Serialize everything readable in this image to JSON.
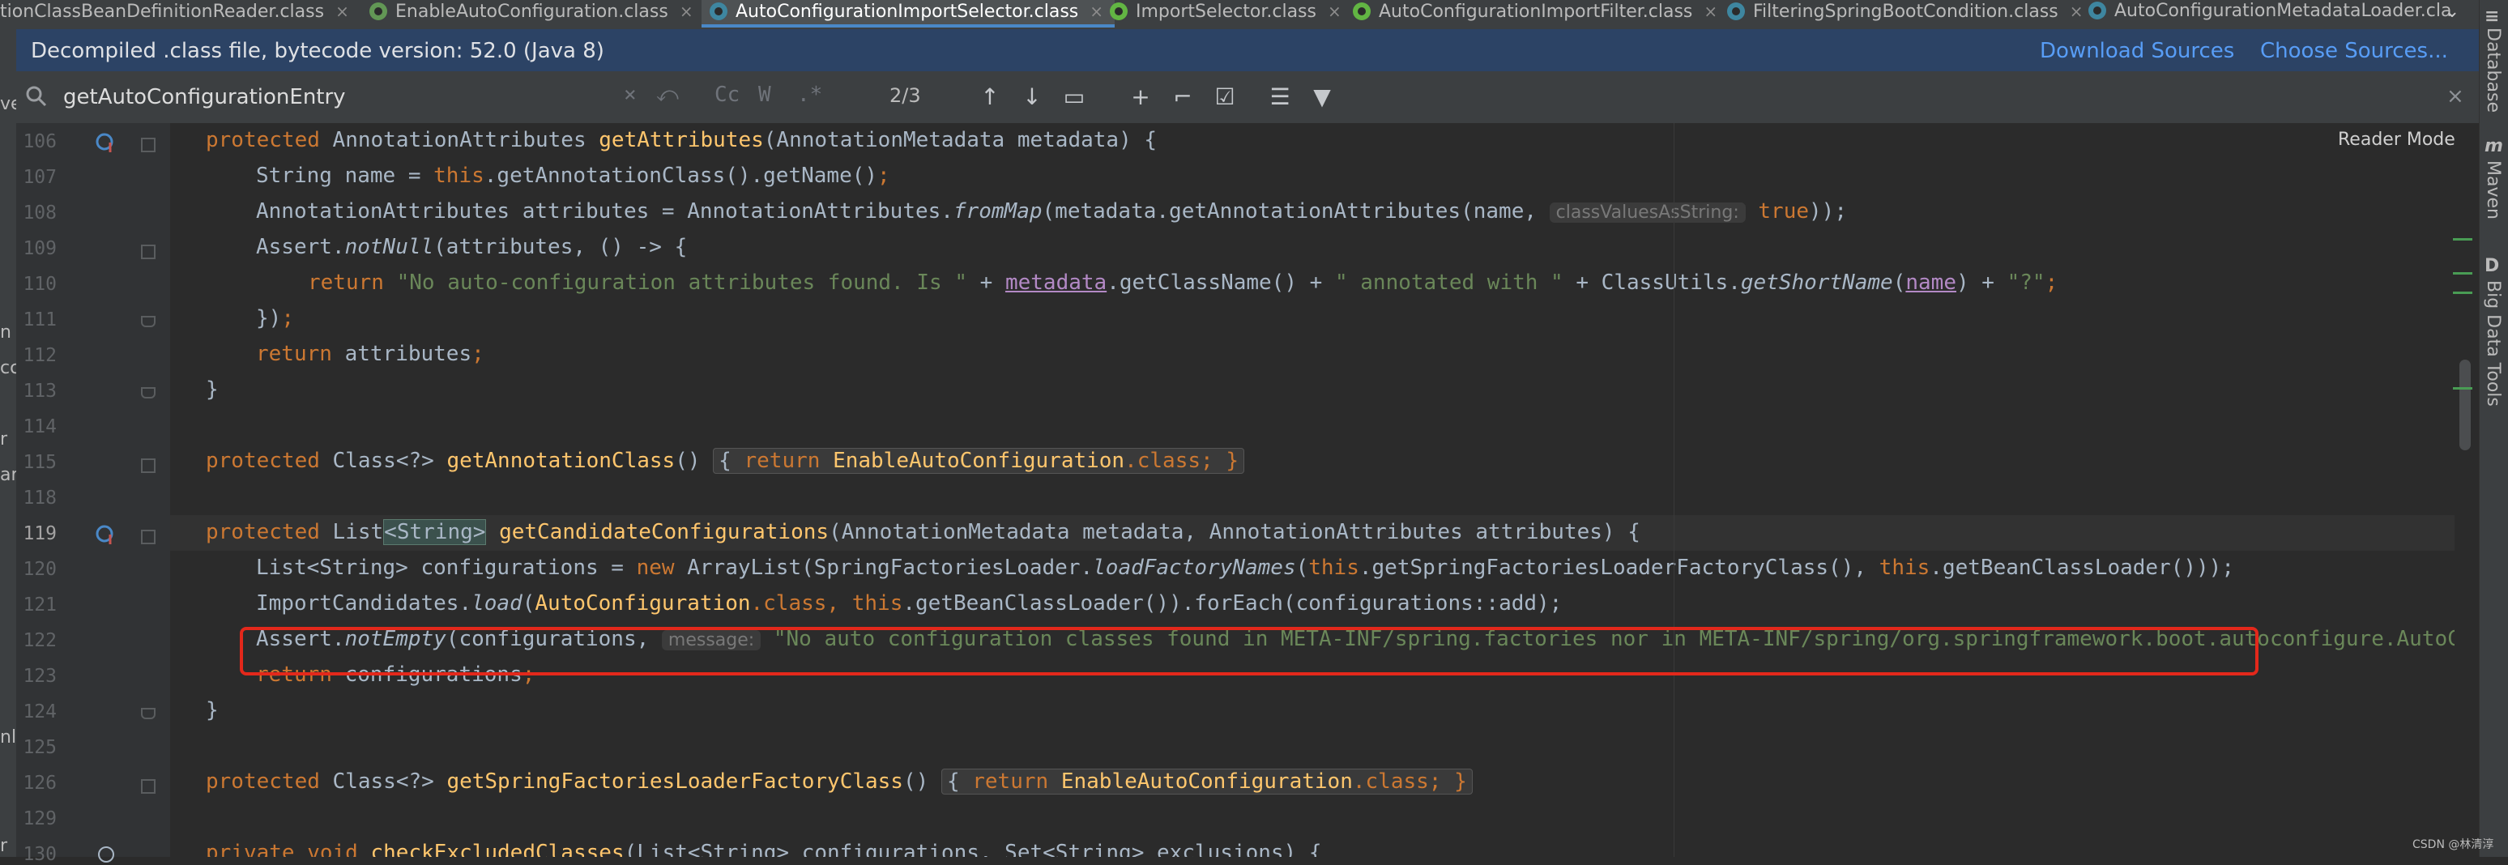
{
  "tabs": [
    {
      "label": "tionClassBeanDefinitionReader.class",
      "icon": "class-icon",
      "active": false
    },
    {
      "label": "EnableAutoConfiguration.class",
      "icon": "annotation-icon",
      "active": false
    },
    {
      "label": "AutoConfigurationImportSelector.class",
      "icon": "class-icon",
      "active": true
    },
    {
      "label": "ImportSelector.class",
      "icon": "interface-icon",
      "active": false
    },
    {
      "label": "AutoConfigurationImportFilter.class",
      "icon": "interface-icon",
      "active": false
    },
    {
      "label": "FilteringSpringBootCondition.class",
      "icon": "class-icon",
      "active": false
    },
    {
      "label": "AutoConfigurationMetadataLoader.cla",
      "icon": "class-icon",
      "active": false
    }
  ],
  "tab_close_glyph": "×",
  "banner": {
    "text": "Decompiled .class file, bytecode version: 52.0 (Java 8)",
    "download_sources": "Download Sources",
    "choose_sources": "Choose Sources..."
  },
  "search": {
    "value": "getAutoConfigurationEntry",
    "match_count": "2/3",
    "case_label": "Cc",
    "word_label": "W",
    "regex_label": ".*"
  },
  "reader_mode": "Reader Mode",
  "right_tools": {
    "database": "Database",
    "maven": "Maven",
    "big_data_tools": "Big Data Tools"
  },
  "left_panel_fragments": [
    "ve",
    "n",
    "cc",
    "r",
    "ar",
    "nl",
    "r"
  ],
  "lines": [
    {
      "n": "106",
      "gutter": "override"
    },
    {
      "n": "107"
    },
    {
      "n": "108"
    },
    {
      "n": "109"
    },
    {
      "n": "110"
    },
    {
      "n": "111"
    },
    {
      "n": "112"
    },
    {
      "n": "113"
    },
    {
      "n": "114"
    },
    {
      "n": "115"
    },
    {
      "n": "118"
    },
    {
      "n": "119",
      "gutter": "override"
    },
    {
      "n": "120"
    },
    {
      "n": "121"
    },
    {
      "n": "122"
    },
    {
      "n": "123"
    },
    {
      "n": "124"
    },
    {
      "n": "125"
    },
    {
      "n": "126"
    },
    {
      "n": "129"
    },
    {
      "n": "130"
    }
  ],
  "code": {
    "l106": {
      "a": "protected ",
      "b": "AnnotationAttributes ",
      "c": "getAttributes",
      "d": "(AnnotationMetadata metadata) {"
    },
    "l107": {
      "a": "String name = ",
      "b": "this",
      "c": ".getAnnotationClass().getName()",
      "d": ";"
    },
    "l108": {
      "a": "AnnotationAttributes attributes = AnnotationAttributes.",
      "b": "fromMap",
      "c": "(metadata.getAnnotationAttributes(name, ",
      "hint": "classValuesAsString:",
      "d": " true",
      "e": "));"
    },
    "l109": {
      "a": "Assert.",
      "b": "notNull",
      "c": "(attributes, () -> {"
    },
    "l110": {
      "a": "return ",
      "b": "\"No auto-configuration attributes found. Is \"",
      "c": " + ",
      "d": "metadata",
      "e": ".getClassName() + ",
      "f": "\" annotated with \"",
      "g": " + ClassUtils.",
      "h": "getShortName",
      "i": "(",
      "j": "name",
      "k": ") + ",
      "l": "\"?\"",
      "m": ";"
    },
    "l111": {
      "a": "})",
      "b": ";"
    },
    "l112": {
      "a": "return ",
      "b": "attributes",
      "c": ";"
    },
    "l113": {
      "a": "}"
    },
    "l115": {
      "a": "protected ",
      "b": "Class<?> ",
      "c": "getAnnotationClass",
      "d": "() ",
      "e": "{ ",
      "f": "return ",
      "g": "EnableAutoConfiguration",
      "h": ".class",
      "i": "; }"
    },
    "l119": {
      "a": "protected ",
      "b": "List",
      "c": "<String>",
      "d": " ",
      "e": "getCandidateConfigurations",
      "f": "(AnnotationMetadata metadata, AnnotationAttributes attributes) {"
    },
    "l120": {
      "a": "List<String> configurations = ",
      "b": "new ",
      "c": "ArrayList(SpringFactoriesLoader.",
      "d": "loadFactoryNames",
      "e": "(",
      "f": "this",
      "g": ".getSpringFactoriesLoaderFactoryClass(), ",
      "h": "this",
      "i": ".getBeanClassLoader()));"
    },
    "l121": {
      "a": "ImportCandidates.",
      "b": "load",
      "c": "(",
      "d": "AutoConfiguration",
      "e": ".class, ",
      "f": "this",
      "g": ".getBeanClassLoader()).forEach(configurations::add);"
    },
    "l122": {
      "a": "Assert.",
      "b": "notEmpty",
      "c": "(configurations, ",
      "hint": "message:",
      "d": " \"No auto configuration classes found in META-INF/spring.factories nor in META-INF/spring/org.springframework.boot.autoconfigure.AutoCon"
    },
    "l123": {
      "a": "return ",
      "b": "configurations",
      "c": ";"
    },
    "l124": {
      "a": "}"
    },
    "l126": {
      "a": "protected ",
      "b": "Class<?> ",
      "c": "getSpringFactoriesLoaderFactoryClass",
      "d": "() ",
      "e": "{ ",
      "f": "return ",
      "g": "EnableAutoConfiguration",
      "h": ".class",
      "i": "; }"
    },
    "l130": {
      "a": "private void ",
      "b": "checkExcludedClasses",
      "c": "(List<String> configurations, Set<String> exclusions) {"
    }
  },
  "watermark": "CSDN @林清淳",
  "colors": {
    "keyword": "#cc7832",
    "method": "#ffc66d",
    "string": "#6a8759",
    "highlight_box": "#e3281b",
    "link": "#589df6"
  }
}
